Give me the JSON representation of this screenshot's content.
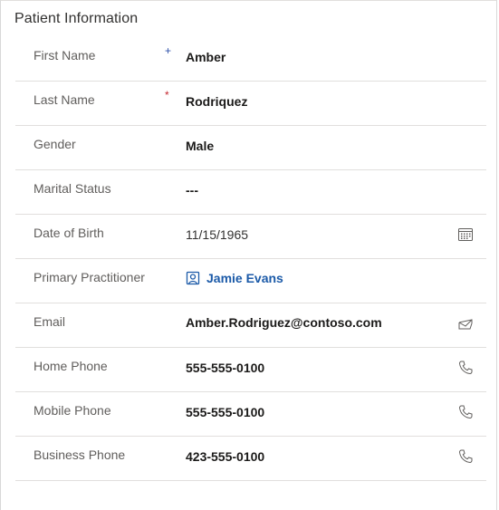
{
  "section": {
    "title": "Patient Information"
  },
  "fields": [
    {
      "label": "First Name",
      "required": "+",
      "value": "Amber"
    },
    {
      "label": "Last Name",
      "required": "*",
      "value": "Rodriquez"
    },
    {
      "label": "Gender",
      "value": "Male"
    },
    {
      "label": "Marital Status",
      "value": "---"
    },
    {
      "label": "Date of Birth",
      "value": "11/15/1965",
      "icon": "calendar-icon"
    },
    {
      "label": "Primary Practitioner",
      "value": "Jamie Evans",
      "icon": "contact-card-icon"
    },
    {
      "label": "Email",
      "value": "Amber.Rodriguez@contoso.com",
      "icon": "email-icon"
    },
    {
      "label": "Home Phone",
      "value": "555-555-0100",
      "icon": "phone-icon"
    },
    {
      "label": "Mobile Phone",
      "value": "555-555-0100",
      "icon": "phone-icon"
    },
    {
      "label": "Business Phone",
      "value": "423-555-0100",
      "icon": "phone-icon"
    }
  ],
  "colors": {
    "required_recommended": "#2b4fa8",
    "required_mandatory": "#c4262e",
    "link": "#1b5aa8",
    "divider": "#e1dfdd"
  }
}
